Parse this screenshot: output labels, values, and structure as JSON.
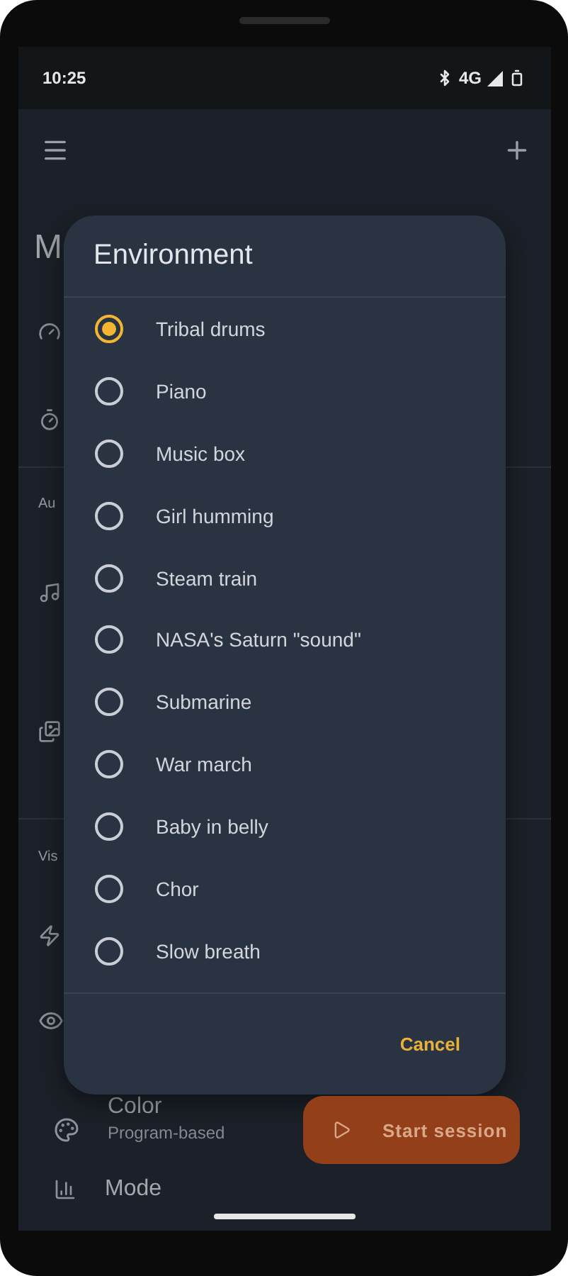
{
  "status_bar": {
    "time": "10:25",
    "network": "4G"
  },
  "background": {
    "title": "M",
    "sections": [
      {
        "label": "Au"
      },
      {
        "label": "Vis"
      }
    ],
    "color_setting": {
      "title": "Color",
      "subtitle": "Program-based"
    },
    "mode_setting": {
      "title": "Mode"
    }
  },
  "dialog": {
    "title": "Environment",
    "options": [
      {
        "label": "Tribal drums",
        "selected": true
      },
      {
        "label": "Piano",
        "selected": false
      },
      {
        "label": "Music box",
        "selected": false
      },
      {
        "label": "Girl humming",
        "selected": false
      },
      {
        "label": "Steam train",
        "selected": false
      },
      {
        "label": "NASA's Saturn \"sound\"",
        "selected": false
      },
      {
        "label": "Submarine",
        "selected": false
      },
      {
        "label": "War march",
        "selected": false
      },
      {
        "label": "Baby in belly",
        "selected": false
      },
      {
        "label": "Chor",
        "selected": false
      },
      {
        "label": "Slow breath",
        "selected": false
      }
    ],
    "buttons": [
      {
        "label": "Cancel"
      }
    ]
  },
  "fab": {
    "label": "Start session"
  }
}
